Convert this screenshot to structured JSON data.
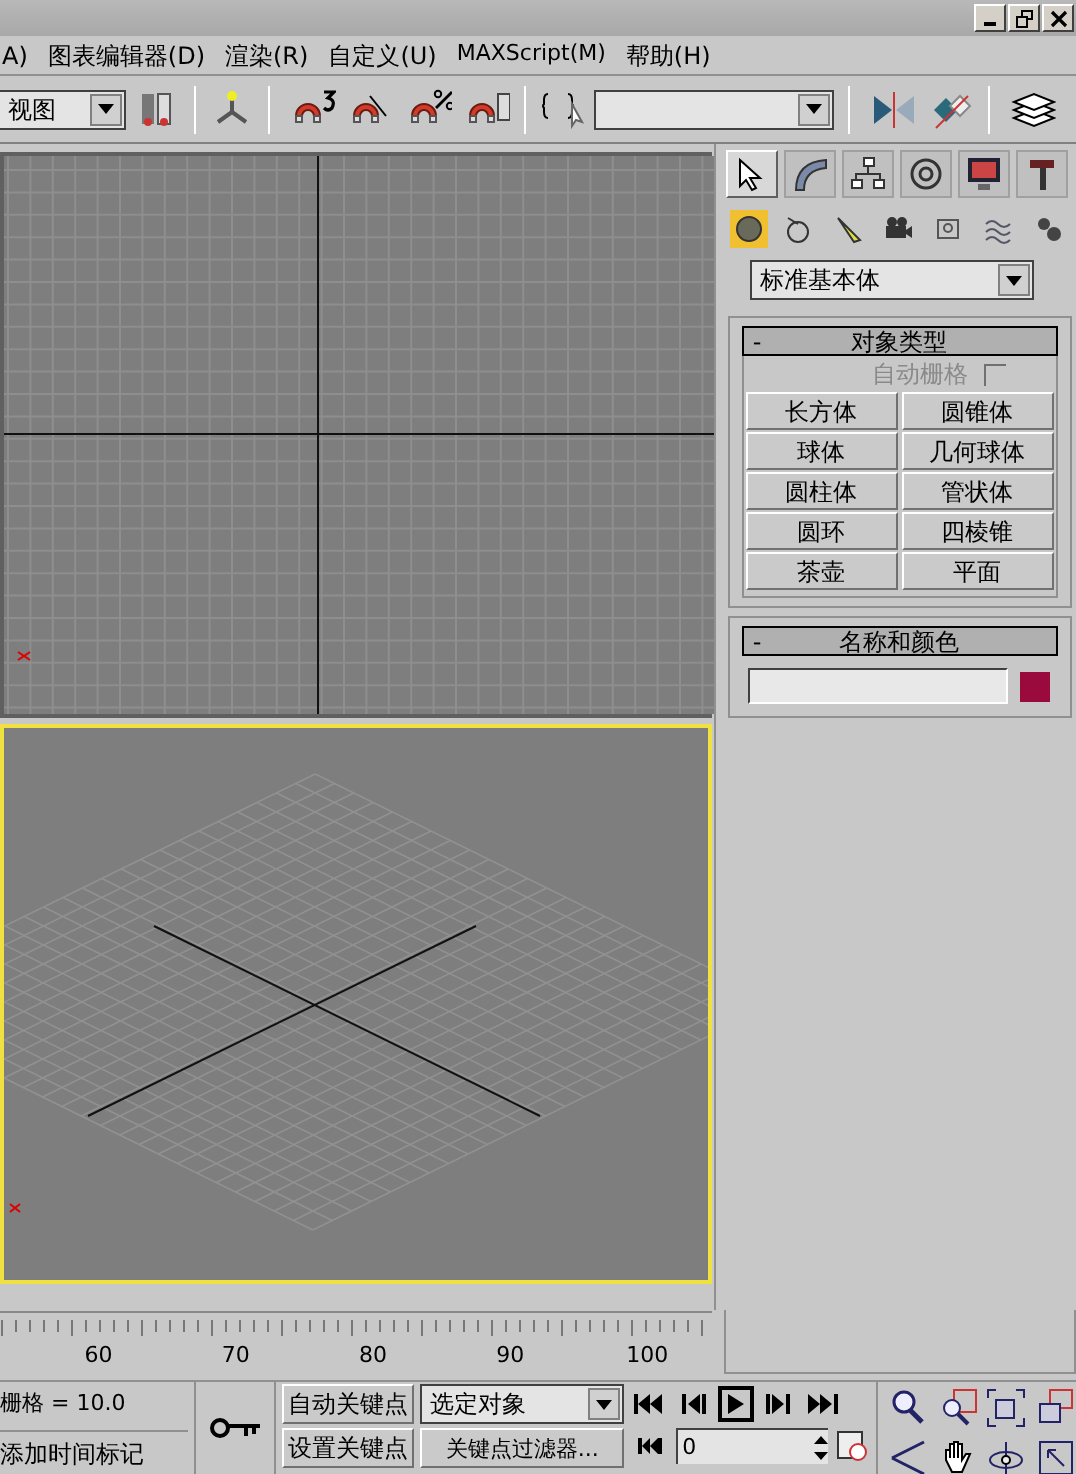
{
  "menu": [
    "A)",
    "图表编辑器(D)",
    "渲染(R)",
    "自定义(U)",
    "MAXScript(M)",
    "帮助(H)"
  ],
  "toolbar": {
    "view_dropdown": "视图"
  },
  "command_panel": {
    "tabs": [
      {
        "selected": true
      },
      {
        "selected": false
      },
      {
        "selected": false
      },
      {
        "selected": false
      },
      {
        "selected": false
      },
      {
        "selected": false
      }
    ],
    "subtabs": [
      {
        "selected": true
      },
      {
        "selected": false
      },
      {
        "selected": false
      },
      {
        "selected": false
      },
      {
        "selected": false
      },
      {
        "selected": false
      },
      {
        "selected": false
      }
    ],
    "category_dropdown": "标准基本体",
    "object_type": {
      "collapse": "-",
      "title": "对象类型",
      "autogrid": {
        "label": "自动栅格",
        "checked": false,
        "disabled": true
      },
      "buttons": [
        "长方体",
        "圆锥体",
        "球体",
        "几何球体",
        "圆柱体",
        "管状体",
        "圆环",
        "四棱锥",
        "茶壶",
        "平面"
      ]
    },
    "name_color": {
      "collapse": "-",
      "title": "名称和颜色",
      "color": "#9a0a3c"
    }
  },
  "viewports": [
    {
      "selected": false
    },
    {
      "selected": true
    }
  ],
  "timeline": {
    "ticks": [
      "60",
      "70",
      "80",
      "90",
      "100"
    ]
  },
  "status": {
    "grid": "栅格 = 10.0",
    "add_time_tag": "添加时间标记"
  },
  "animation": {
    "auto_key": "自动关键点",
    "set_key": "设置关键点",
    "selection_dropdown": "选定对象",
    "key_filters": "关键点过滤器...",
    "frame": "0"
  }
}
